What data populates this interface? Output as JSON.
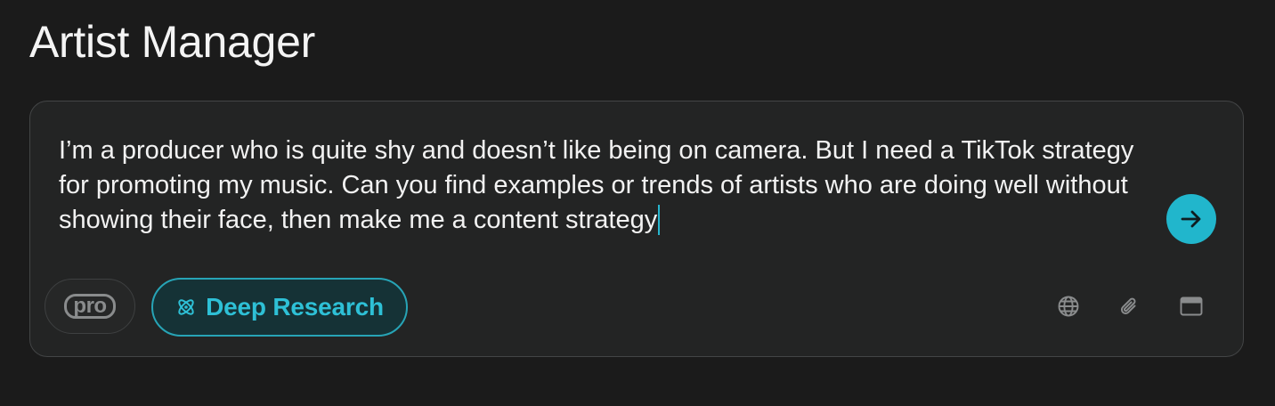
{
  "page": {
    "title": "Artist Manager"
  },
  "composer": {
    "prompt_text": "I’m a producer who is quite shy and doesn’t like being on camera. But I need a TikTok strategy for promoting my music. Can you find examples or trends of artists who are doing well without showing their face, then make me a content strategy",
    "send_icon": "arrow-right-icon",
    "pro_label": "pro",
    "deep_research": {
      "label": "Deep Research",
      "icon": "atom-icon",
      "active": true
    },
    "tools": [
      {
        "icon": "globe-icon"
      },
      {
        "icon": "paperclip-icon"
      },
      {
        "icon": "browser-window-icon"
      }
    ]
  },
  "colors": {
    "background": "#1b1b1b",
    "composer_background": "#232424",
    "accent": "#21b6cc",
    "deep_research_background": "#153236",
    "text": "#f2f2f2",
    "muted_icon": "#8a8c8d"
  }
}
